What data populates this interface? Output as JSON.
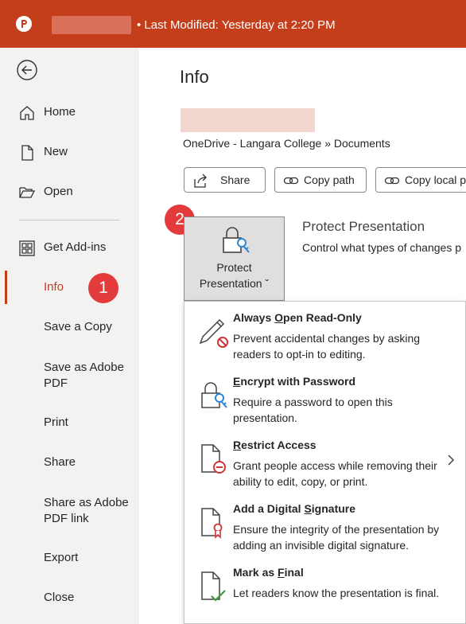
{
  "titlebar": {
    "last_modified": "• Last Modified: Yesterday at 2:20 PM",
    "app_icon": "powerpoint-logo"
  },
  "sidebar": {
    "back_icon": "back-arrow-icon",
    "items": [
      {
        "label": "Home",
        "icon": "home-icon"
      },
      {
        "label": "New",
        "icon": "new-doc-icon"
      },
      {
        "label": "Open",
        "icon": "open-folder-icon"
      },
      {
        "label": "Get Add-ins",
        "icon": "add-ins-icon"
      },
      {
        "label": "Info"
      },
      {
        "label": "Save a Copy"
      },
      {
        "label": "Save as Adobe PDF"
      },
      {
        "label": "Print"
      },
      {
        "label": "Share"
      },
      {
        "label": "Share as Adobe PDF link"
      },
      {
        "label": "Export"
      },
      {
        "label": "Close"
      }
    ],
    "save_as_adobe_l1": "Save as Adobe",
    "save_as_adobe_l2": "PDF",
    "share_adobe_l1": "Share as Adobe",
    "share_adobe_l2": "PDF link",
    "badge1": "1"
  },
  "main": {
    "title": "Info",
    "path": "OneDrive - Langara College » Documents",
    "buttons": {
      "share": "Share",
      "copy_path": "Copy path",
      "copy_local": "Copy local p"
    },
    "badge2": "2",
    "protect_btn": {
      "line1": "Protect",
      "line2": "Presentation ˇ"
    },
    "section_title": "Protect Presentation",
    "section_desc": "Control what types of changes p"
  },
  "menu": {
    "items": [
      {
        "title_pre": "Always ",
        "title_u": "O",
        "title_post": "pen Read-Only",
        "desc": "Prevent accidental changes by asking readers to opt-in to editing.",
        "icon": "pencil-no-edit-icon"
      },
      {
        "title_pre": "",
        "title_u": "E",
        "title_post": "ncrypt with Password",
        "desc": "Require a password to open this presentation.",
        "icon": "lock-key-icon"
      },
      {
        "title_pre": "",
        "title_u": "R",
        "title_post": "estrict Access",
        "desc": "Grant people access while removing their ability to edit, copy, or print.",
        "icon": "restricted-doc-icon"
      },
      {
        "title_pre": "Add a Digital ",
        "title_u": "S",
        "title_post": "ignature",
        "desc": "Ensure the integrity of the presentation by adding an invisible digital signature.",
        "icon": "signature-doc-icon"
      },
      {
        "title_pre": "Mark as ",
        "title_u": "F",
        "title_post": "inal",
        "desc": "Let readers know the presentation is final.",
        "icon": "final-doc-icon"
      }
    ]
  }
}
